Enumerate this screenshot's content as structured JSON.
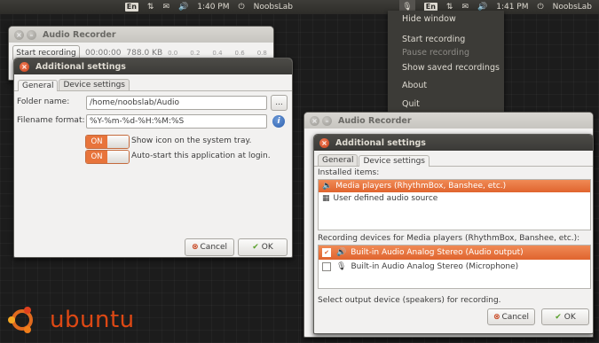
{
  "left_panel": {
    "lang": "En",
    "time": "1:40 PM",
    "user": "NoobsLab"
  },
  "right_panel": {
    "lang": "En",
    "time": "1:41 PM",
    "user": "NoobsLab"
  },
  "menu": {
    "items": [
      "Hide window",
      "Start recording",
      "Pause recording",
      "Show saved recordings",
      "About",
      "Quit"
    ]
  },
  "bg_window_left": {
    "title": "Audio Recorder",
    "start_label": "Start recording",
    "time": "00:00:00",
    "size": "788.0 KB",
    "levels": [
      "0.0",
      "0.2",
      "0.4",
      "0.6",
      "0.8"
    ]
  },
  "settings_left": {
    "title": "Additional settings",
    "tabs": [
      "General",
      "Device settings"
    ],
    "folder_label": "Folder name:",
    "folder_value": "/home/noobslab/Audio",
    "browse_label": "...",
    "format_label": "Filename format:",
    "format_value": "%Y-%m-%d-%H:%M:%S",
    "toggle_on": "ON",
    "tray_label": "Show icon on the system tray.",
    "autostart_label": "Auto-start this application at login.",
    "cancel": "Cancel",
    "ok": "OK"
  },
  "bg_window_right": {
    "title": "Audio Recorder"
  },
  "settings_right": {
    "title": "Additional settings",
    "tabs": [
      "General",
      "Device settings"
    ],
    "installed_label": "Installed items:",
    "installed": [
      "Media players (RhythmBox, Banshee, etc.)",
      "User defined audio source"
    ],
    "devices_label": "Recording devices for Media players (RhythmBox, Banshee, etc.):",
    "devices": [
      {
        "label": "Built-in Audio Analog Stereo (Audio output)",
        "checked": true
      },
      {
        "label": "Built-in Audio Analog Stereo (Microphone)",
        "checked": false
      }
    ],
    "hint": "Select output device (speakers) for recording.",
    "cancel": "Cancel",
    "ok": "OK"
  },
  "brand": {
    "text": "ubuntu"
  },
  "colors": {
    "accent": "#e0642e",
    "brand": "#dd4814",
    "panel": "#2d2c29"
  }
}
